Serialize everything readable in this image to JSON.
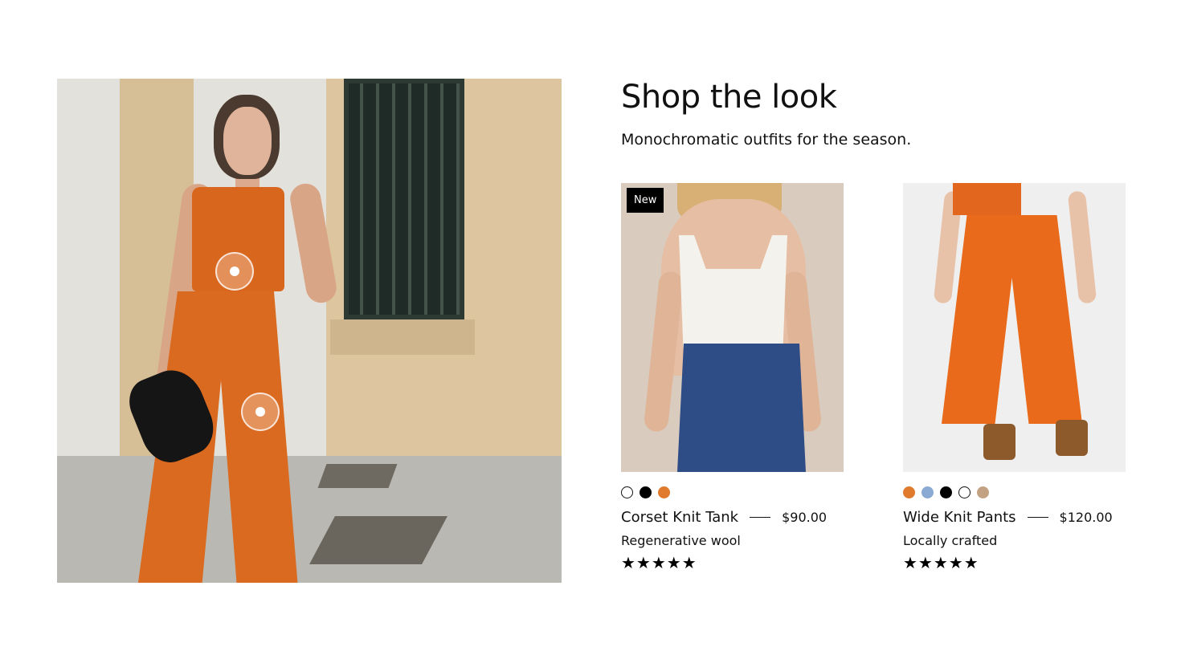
{
  "section": {
    "title": "Shop the look",
    "subtitle": "Monochromatic outfits for the season."
  },
  "lookbook": {
    "hotspots": [
      {
        "name": "hotspot-top"
      },
      {
        "name": "hotspot-pants"
      }
    ]
  },
  "products": [
    {
      "badge": "New",
      "name": "Corset Knit Tank",
      "price": "$90.00",
      "description": "Regenerative wool",
      "rating": "★★★★★",
      "swatches": [
        "#ffffff",
        "#000000",
        "#e07a2c"
      ]
    },
    {
      "name": "Wide Knit Pants",
      "price": "$120.00",
      "description": "Locally crafted",
      "rating": "★★★★★",
      "swatches": [
        "#e07a2c",
        "#8aa9d3",
        "#000000",
        "#ffffff",
        "#c2a283"
      ]
    }
  ],
  "colors": {
    "accent": "#e86a1a",
    "text": "#111111"
  }
}
